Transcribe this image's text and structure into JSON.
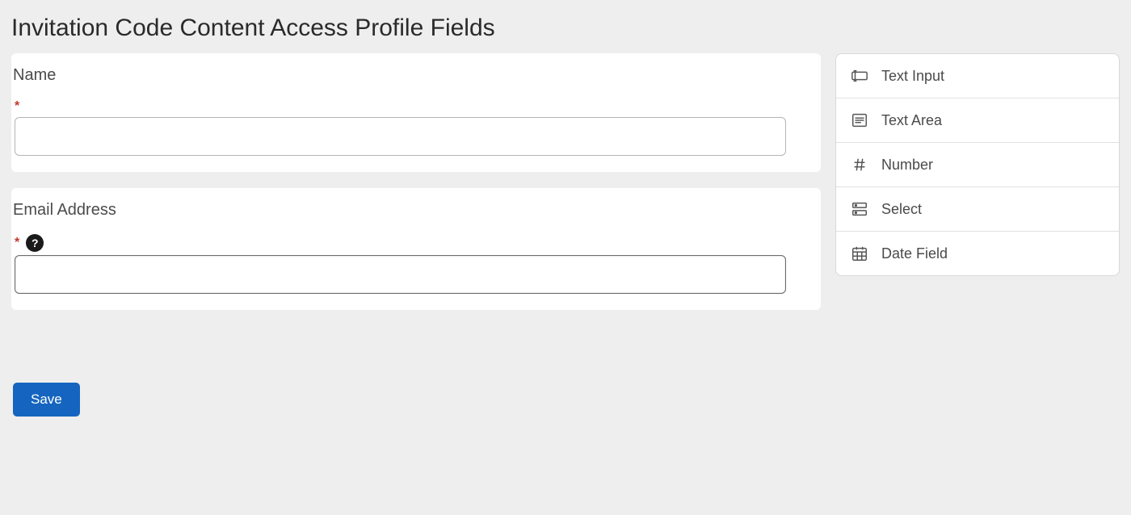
{
  "page": {
    "title": "Invitation Code Content Access Profile Fields"
  },
  "fields": [
    {
      "label": "Name",
      "required_mark": "*",
      "help": false,
      "value": ""
    },
    {
      "label": "Email Address",
      "required_mark": "*",
      "help": true,
      "help_text": "?",
      "value": ""
    }
  ],
  "buttons": {
    "save": "Save"
  },
  "field_types": [
    {
      "label": "Text Input",
      "icon": "text-input-icon"
    },
    {
      "label": "Text Area",
      "icon": "text-area-icon"
    },
    {
      "label": "Number",
      "icon": "number-icon"
    },
    {
      "label": "Select",
      "icon": "select-icon"
    },
    {
      "label": "Date Field",
      "icon": "date-field-icon"
    }
  ]
}
